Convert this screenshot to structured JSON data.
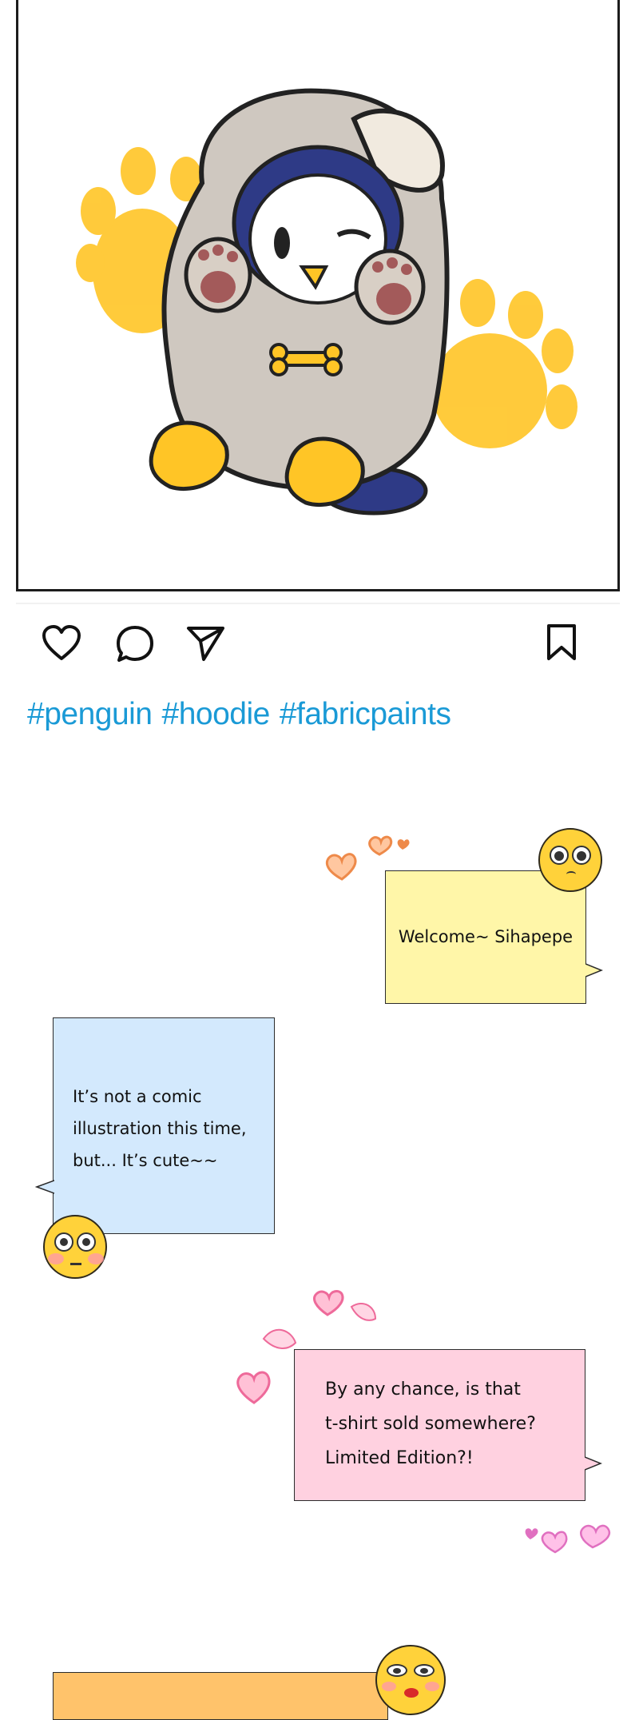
{
  "post": {
    "image_alt": "penguin wearing a grey puppy hoodie with yellow paw prints",
    "colors": {
      "hashtag": "#1a9ad6",
      "frame_border": "#1c1c1c"
    }
  },
  "actions": {
    "like_icon": "heart-icon",
    "comment_icon": "comment-icon",
    "share_icon": "send-icon",
    "save_icon": "bookmark-icon"
  },
  "hashtags": [
    "#penguin",
    "#hoodie",
    "#fabricpaints"
  ],
  "chat": [
    {
      "text": "Welcome~ Sihapepe",
      "color": "#fff6a8"
    },
    {
      "text": "It's not a comic illustration this time, but... It's cute~~",
      "lines": [
        "It’s not a comic",
        "illustration this time,",
        "but... It’s cute~~"
      ],
      "color": "#d3e9fd"
    },
    {
      "text": "By any chance, is that t-shirt sold somewhere? Limited Edition?!",
      "lines": [
        "By any chance, is that",
        "t-shirt sold somewhere?",
        "Limited Edition?!"
      ],
      "color": "#ffd1e0"
    },
    {
      "text": "",
      "color": "#ffc36b"
    }
  ]
}
